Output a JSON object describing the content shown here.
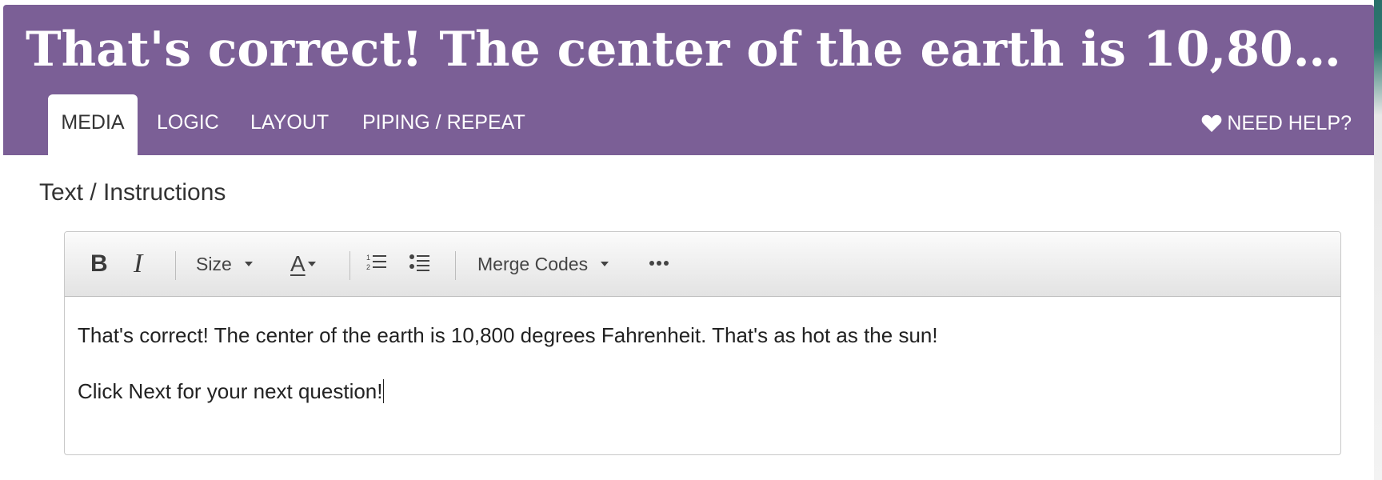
{
  "header": {
    "title": "That's correct! The center of the earth is 10,800 degrees F...",
    "background_color": "#7b5f96"
  },
  "tabs": [
    {
      "label": "MEDIA",
      "active": true
    },
    {
      "label": "LOGIC",
      "active": false
    },
    {
      "label": "LAYOUT",
      "active": false
    },
    {
      "label": "PIPING / REPEAT",
      "active": false
    }
  ],
  "help": {
    "label": "NEED HELP?",
    "icon": "heart-icon"
  },
  "section": {
    "label": "Text / Instructions"
  },
  "toolbar": {
    "bold_label": "B",
    "italic_label": "I",
    "size_label": "Size",
    "font_color_label": "A",
    "merge_codes_label": "Merge Codes",
    "icons": [
      "bold-icon",
      "italic-icon",
      "chevron-down-icon",
      "font-color-icon",
      "ordered-list-icon",
      "unordered-list-icon",
      "more-options-icon"
    ]
  },
  "editor": {
    "paragraphs": [
      "That's correct! The center of the earth is 10,800 degrees Fahrenheit. That's as hot as the sun!",
      "Click Next for your next question!"
    ]
  }
}
